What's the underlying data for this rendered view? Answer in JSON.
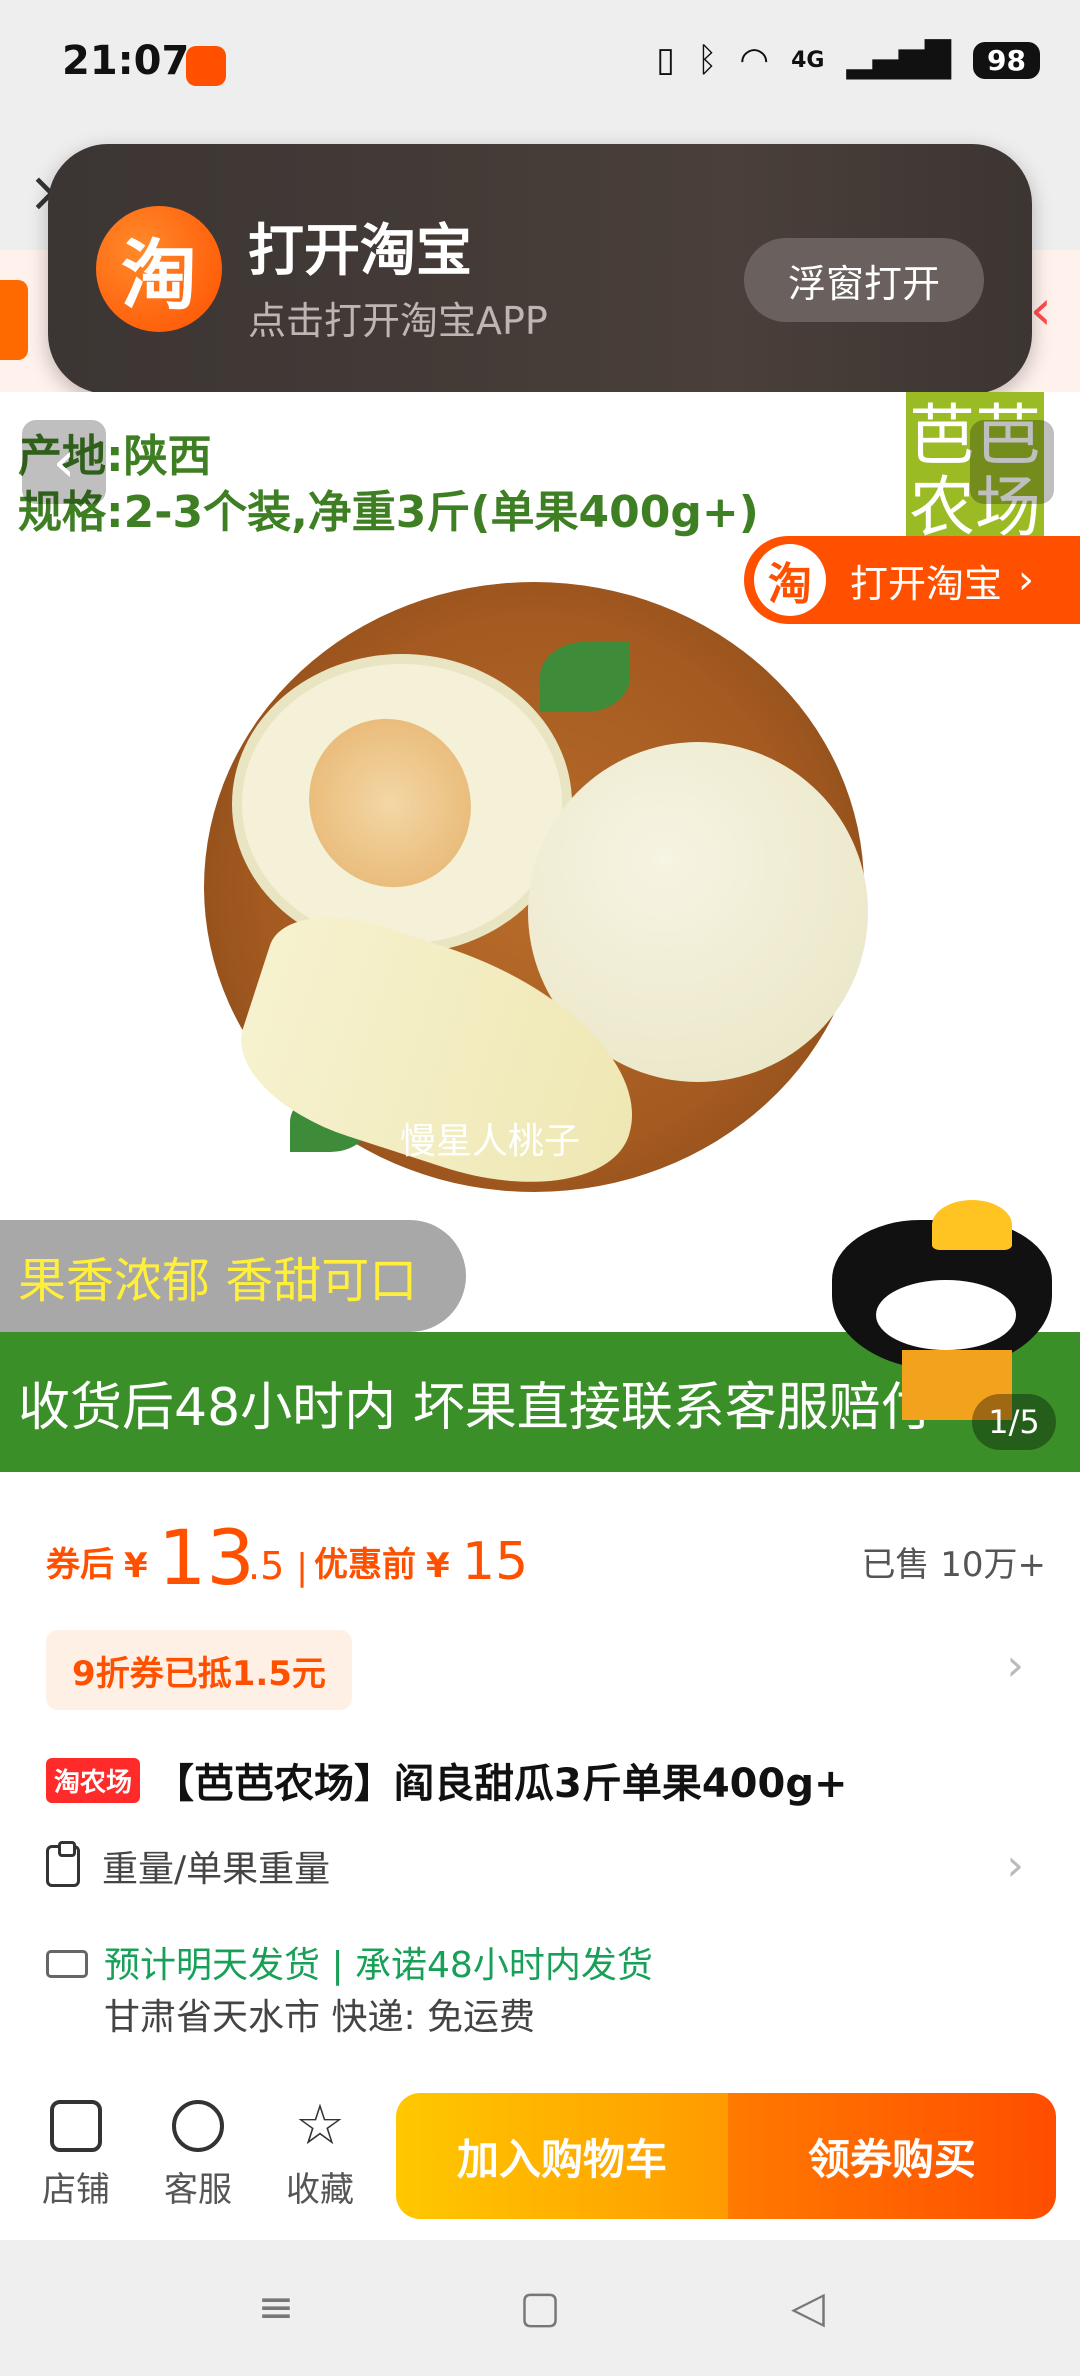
{
  "status_bar": {
    "time": "21:07",
    "network": "4G",
    "battery": "98",
    "app_badge": "淘"
  },
  "overlay": {
    "logo_char": "淘",
    "title": "打开淘宝",
    "subtitle": "点击打开淘宝APP",
    "button": "浮窗打开"
  },
  "hero": {
    "spec_origin": "产地:陕西",
    "spec_size": "规格:2-3个装,净重3斤(单果400g+)",
    "brand_box": "芭芭农场",
    "open_taobao": "打开淘宝",
    "open_taobao_icon": "淘",
    "watermark": "慢星人桃子",
    "slogan": "果香浓郁 香甜可口",
    "guarantee": "收货后48小时内 坏果直接联系客服赔付",
    "counter": "1/5"
  },
  "price": {
    "after_label": "券后",
    "currency": "¥",
    "after_int": "13",
    "after_dec": ".5",
    "separator": "|",
    "before_label": "优惠前",
    "before_value": "15",
    "sold": "已售 10万+"
  },
  "coupon": {
    "text": "9折券已抵1.5元"
  },
  "product": {
    "tag": "淘农场",
    "title": "【芭芭农场】阎良甜瓜3斤单果400g+"
  },
  "spec_select": {
    "label": "重量/单果重量"
  },
  "shipping": {
    "main": "预计明天发货 | 承诺48小时内发货",
    "sub": "甘肃省天水市  快递: 免运费"
  },
  "actions": {
    "shop": "店铺",
    "service": "客服",
    "favorite": "收藏",
    "add_cart": "加入购物车",
    "buy": "领券购买"
  },
  "colors": {
    "accent": "#ff5000",
    "green": "#3a8f28",
    "shipping_green": "#18a058"
  }
}
